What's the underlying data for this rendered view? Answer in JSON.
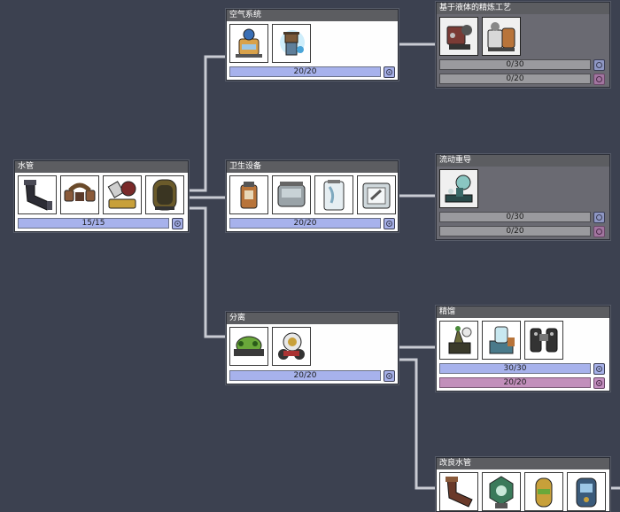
{
  "nodes": {
    "air_system": {
      "title": "空气系统",
      "progress": "20/20",
      "fill": 1.0
    },
    "liquid_refining": {
      "title": "基于液体的精炼工艺",
      "progress_1": "0/30",
      "fill_1": 0.0,
      "progress_2": "0/20",
      "fill_2": 0.0
    },
    "pipes": {
      "title": "水管",
      "progress": "15/15",
      "fill": 1.0
    },
    "sanitation": {
      "title": "卫生设备",
      "progress": "20/20",
      "fill": 1.0
    },
    "flow_redirect": {
      "title": "流动重导",
      "progress_1": "0/30",
      "fill_1": 0.0,
      "progress_2": "0/20",
      "fill_2": 0.0
    },
    "separation": {
      "title": "分离",
      "progress": "20/20",
      "fill": 1.0
    },
    "distillation": {
      "title": "精馏",
      "progress_1": "30/30",
      "fill_1": 1.0,
      "progress_2": "20/20",
      "fill_2": 1.0
    },
    "improved_pipes": {
      "title": "改良水管"
    }
  },
  "colors": {
    "background": "#3c4150",
    "connector": "#c9cbd3",
    "research_blue": "#a7b2ec",
    "research_pink": "#c28fbb",
    "locked_panel": "#6a6a72"
  },
  "icons": [
    "electrolyzer-icon",
    "oxygen-diffuser-icon",
    "rust-deoxidizer-icon",
    "oxylite-refinery-icon",
    "liquid-pipe-icon",
    "liquid-bridge-icon",
    "liquid-pump-icon",
    "liquid-reservoir-icon",
    "outhouse-icon",
    "sink-icon",
    "shower-icon",
    "wash-basin-icon",
    "liquid-valve-icon",
    "water-sieve-icon",
    "algae-distiller-icon",
    "liquid-meter-icon",
    "ethanol-distiller-icon",
    "liquid-filter-icon",
    "insulated-pipe-icon",
    "liquid-shutoff-icon",
    "liquid-tank-icon",
    "liquid-cooler-icon"
  ]
}
